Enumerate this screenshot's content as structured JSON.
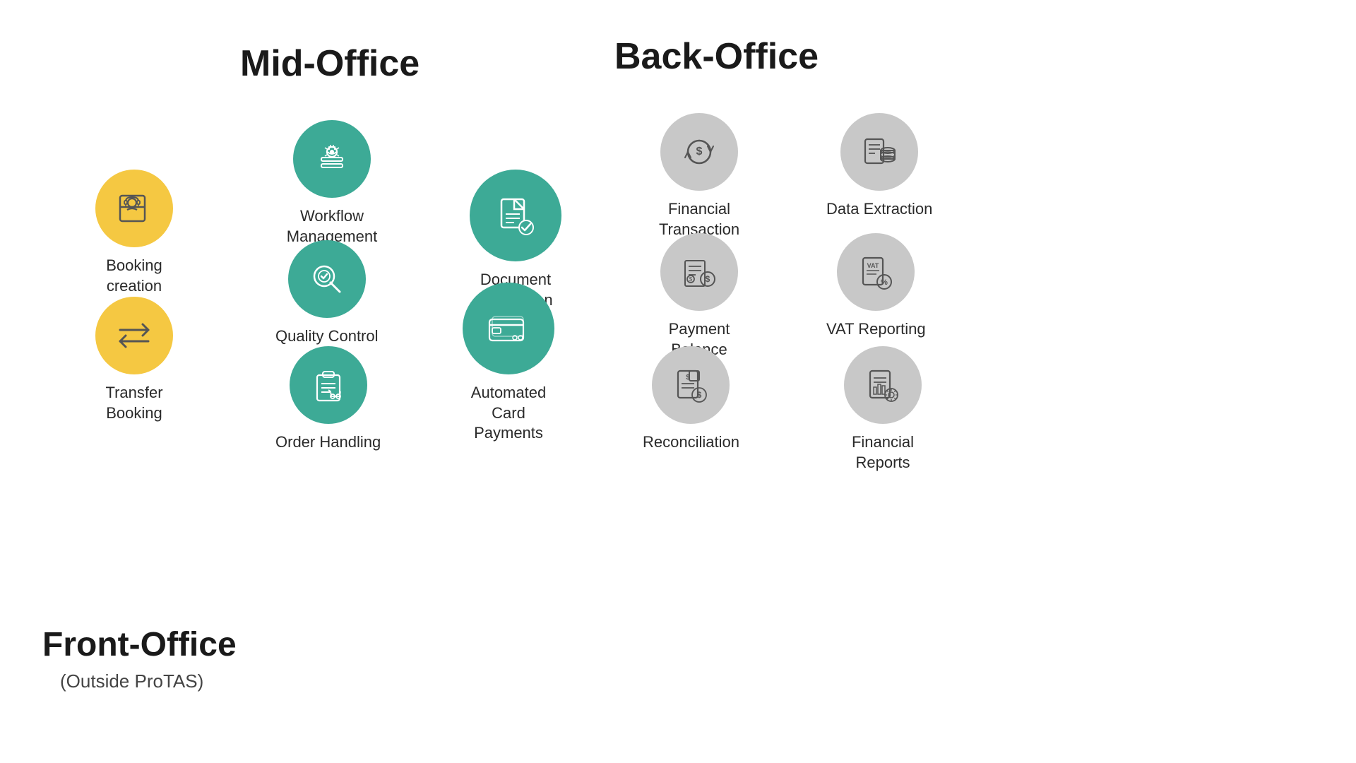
{
  "headers": {
    "mid_office": "Mid-Office",
    "back_office": "Back-Office",
    "front_office": "Front-Office",
    "front_office_sub": "(Outside ProTAS)"
  },
  "front_office": {
    "booking": {
      "label": "Booking creation"
    },
    "transfer": {
      "label": "Transfer Booking"
    }
  },
  "mid_office": {
    "workflow": {
      "label": "Workflow Management"
    },
    "quality": {
      "label": "Quality Control"
    },
    "order": {
      "label": "Order Handling"
    },
    "document": {
      "label": "Document Production"
    },
    "card": {
      "label": "Automated Card\nPayments"
    }
  },
  "back_office": {
    "financial_tx": {
      "label": "Financial Transaction"
    },
    "payment": {
      "label": "Payment Balance"
    },
    "reconciliation": {
      "label": "Reconciliation"
    },
    "data_extraction": {
      "label": "Data Extraction"
    },
    "vat": {
      "label": "VAT Reporting"
    },
    "financial_reports": {
      "label": "Financial Reports"
    }
  }
}
